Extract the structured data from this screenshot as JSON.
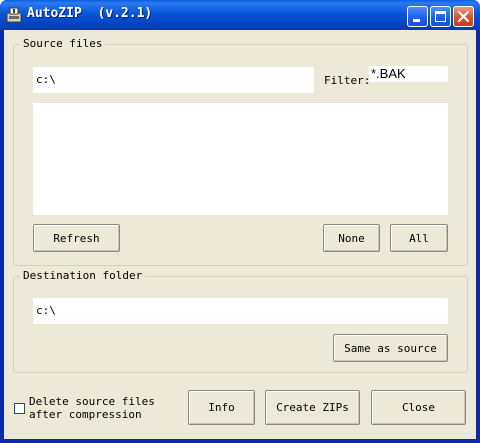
{
  "window": {
    "title": "AutoZIP  (v.2.1)",
    "app_icon": "autozip-app-icon",
    "controls": [
      "minimize-icon",
      "maximize-icon",
      "close-icon"
    ]
  },
  "source": {
    "group_label": "Source files",
    "path_value": "c:\\",
    "filter_label": "Filter:",
    "filter_value": "*.BAK",
    "file_list_items": [],
    "refresh_label": "Refresh",
    "none_label": "None",
    "all_label": "All"
  },
  "destination": {
    "group_label": "Destination folder",
    "path_value": "c:\\",
    "same_as_source_label": "Same as source"
  },
  "options": {
    "delete_checked": false,
    "delete_line1": "Delete source files",
    "delete_line2": "after compression"
  },
  "actions": {
    "info_label": "Info",
    "create_label": "Create ZIPs",
    "close_label": "Close"
  },
  "colors": {
    "titlebar": "#0a56d8",
    "dialog_bg": "#ece9d8",
    "close_button": "#e0542c"
  }
}
